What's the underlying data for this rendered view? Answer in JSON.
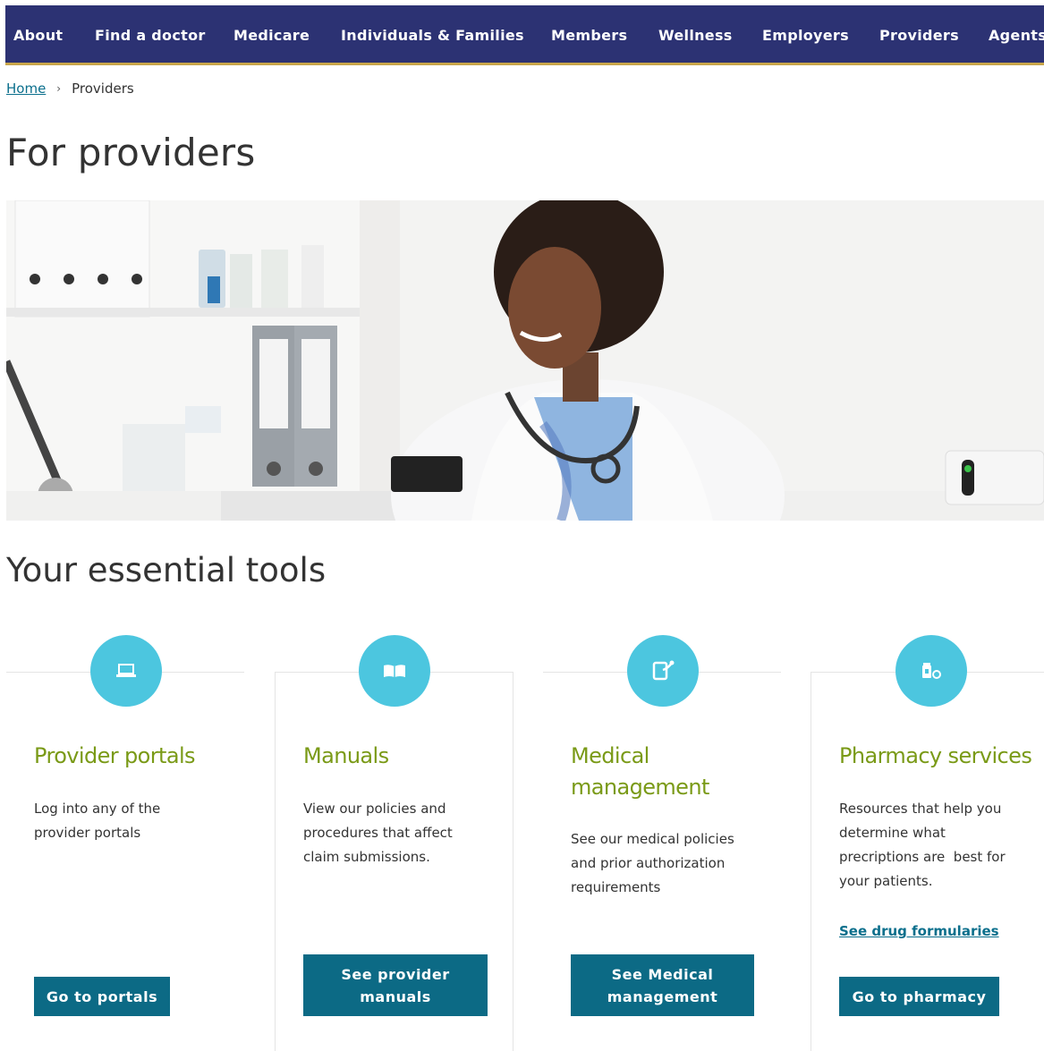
{
  "nav": {
    "items": [
      "About",
      "Find a doctor",
      "Medicare",
      "Individuals & Families",
      "Members",
      "Wellness",
      "Employers",
      "Providers",
      "Agents"
    ]
  },
  "breadcrumb": {
    "home": "Home",
    "current": "Providers"
  },
  "page_title": "For providers",
  "section_title": "Your essential tools",
  "colors": {
    "nav_bg": "#2c3273",
    "accent_gold": "#c9a64a",
    "icon_circle": "#4cc6df",
    "card_title": "#7a9a17",
    "button": "#0c6a85",
    "link": "#0b6f8c"
  },
  "cards": [
    {
      "icon": "laptop-icon",
      "title": "Provider portals",
      "description_lines": [
        "Log into any of the",
        "provider portals"
      ],
      "button_lines": [
        "Go to portals"
      ]
    },
    {
      "icon": "book-icon",
      "title": "Manuals",
      "description_lines": [
        "View our policies and",
        "procedures that affect",
        "claim submissions."
      ],
      "button_lines": [
        "See provider",
        "manuals"
      ]
    },
    {
      "icon": "clipboard-stethoscope-icon",
      "title_lines": [
        "Medical",
        "management"
      ],
      "description_lines": [
        "See our medical policies",
        "and prior authorization",
        "requirements"
      ],
      "button_lines": [
        "See Medical",
        "management"
      ]
    },
    {
      "icon": "pill-bottle-icon",
      "title": "Pharmacy services",
      "description_lines": [
        "Resources that help you",
        "determine what",
        "precriptions are  best for",
        "your patients."
      ],
      "link": "See drug formularies",
      "button_lines": [
        "Go to pharmacy"
      ]
    }
  ]
}
